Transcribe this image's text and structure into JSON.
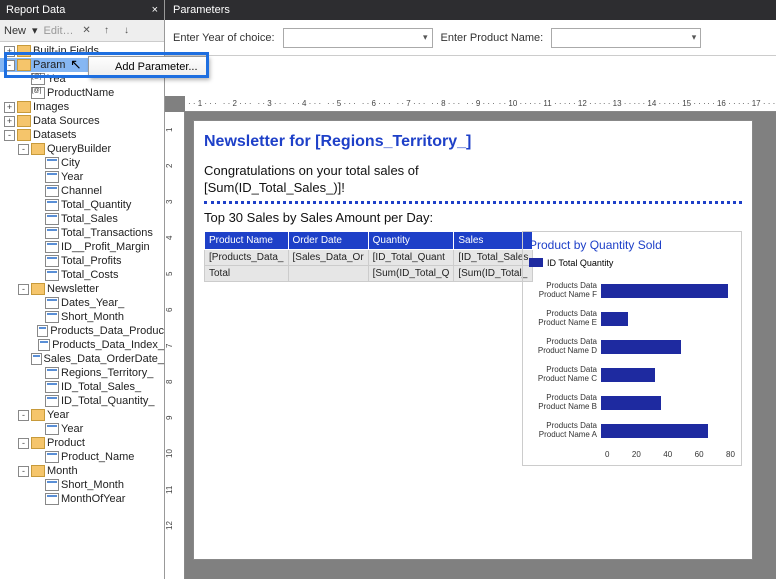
{
  "left": {
    "title": "Report Data",
    "toolbar": {
      "new": "New",
      "edit": "Edit…"
    },
    "tree": [
      {
        "depth": 0,
        "expander": "+",
        "icon": "folder",
        "label": "Built-in Fields"
      },
      {
        "depth": 0,
        "expander": "-",
        "icon": "folder",
        "label": "Param",
        "selected": true
      },
      {
        "depth": 1,
        "expander": "",
        "icon": "param",
        "label": "Yea"
      },
      {
        "depth": 1,
        "expander": "",
        "icon": "param",
        "label": "ProductName"
      },
      {
        "depth": 0,
        "expander": "+",
        "icon": "folder",
        "label": "Images"
      },
      {
        "depth": 0,
        "expander": "+",
        "icon": "folder",
        "label": "Data Sources"
      },
      {
        "depth": 0,
        "expander": "-",
        "icon": "folder",
        "label": "Datasets"
      },
      {
        "depth": 1,
        "expander": "-",
        "icon": "folder",
        "label": "QueryBuilder"
      },
      {
        "depth": 2,
        "expander": "",
        "icon": "field",
        "label": "City"
      },
      {
        "depth": 2,
        "expander": "",
        "icon": "field",
        "label": "Year"
      },
      {
        "depth": 2,
        "expander": "",
        "icon": "field",
        "label": "Channel"
      },
      {
        "depth": 2,
        "expander": "",
        "icon": "field",
        "label": "Total_Quantity"
      },
      {
        "depth": 2,
        "expander": "",
        "icon": "field",
        "label": "Total_Sales"
      },
      {
        "depth": 2,
        "expander": "",
        "icon": "field",
        "label": "Total_Transactions"
      },
      {
        "depth": 2,
        "expander": "",
        "icon": "field",
        "label": "ID__Profit_Margin"
      },
      {
        "depth": 2,
        "expander": "",
        "icon": "field",
        "label": "Total_Profits"
      },
      {
        "depth": 2,
        "expander": "",
        "icon": "field",
        "label": "Total_Costs"
      },
      {
        "depth": 1,
        "expander": "-",
        "icon": "folder",
        "label": "Newsletter"
      },
      {
        "depth": 2,
        "expander": "",
        "icon": "field",
        "label": "Dates_Year_"
      },
      {
        "depth": 2,
        "expander": "",
        "icon": "field",
        "label": "Short_Month"
      },
      {
        "depth": 2,
        "expander": "",
        "icon": "field",
        "label": "Products_Data_Produc"
      },
      {
        "depth": 2,
        "expander": "",
        "icon": "field",
        "label": "Products_Data_Index_"
      },
      {
        "depth": 2,
        "expander": "",
        "icon": "field",
        "label": "Sales_Data_OrderDate_"
      },
      {
        "depth": 2,
        "expander": "",
        "icon": "field",
        "label": "Regions_Territory_"
      },
      {
        "depth": 2,
        "expander": "",
        "icon": "field",
        "label": "ID_Total_Sales_"
      },
      {
        "depth": 2,
        "expander": "",
        "icon": "field",
        "label": "ID_Total_Quantity_"
      },
      {
        "depth": 1,
        "expander": "-",
        "icon": "folder",
        "label": "Year"
      },
      {
        "depth": 2,
        "expander": "",
        "icon": "field",
        "label": "Year"
      },
      {
        "depth": 1,
        "expander": "-",
        "icon": "folder",
        "label": "Product"
      },
      {
        "depth": 2,
        "expander": "",
        "icon": "field",
        "label": "Product_Name"
      },
      {
        "depth": 1,
        "expander": "-",
        "icon": "folder",
        "label": "Month"
      },
      {
        "depth": 2,
        "expander": "",
        "icon": "field",
        "label": "Short_Month"
      },
      {
        "depth": 2,
        "expander": "",
        "icon": "field",
        "label": "MonthOfYear"
      }
    ]
  },
  "context_menu": {
    "item": "Add Parameter..."
  },
  "params": {
    "header": "Parameters",
    "label1": "Enter Year of choice:",
    "label2": "Enter Product Name:"
  },
  "ruler_h": [
    "1",
    "2",
    "3",
    "4",
    "5",
    "6",
    "7",
    "8",
    "9",
    "10",
    "11",
    "12",
    "13",
    "14",
    "15",
    "16",
    "17"
  ],
  "ruler_v": [
    "1",
    "2",
    "3",
    "4",
    "5",
    "6",
    "7",
    "8",
    "9",
    "10",
    "11",
    "12"
  ],
  "report": {
    "title": "Newsletter for [Regions_Territory_]",
    "congrats1": "Congratulations on your total sales of",
    "congrats2": "[Sum(ID_Total_Sales_)]!",
    "subtitle": "Top 30 Sales by Sales Amount per Day:",
    "table": {
      "headers": [
        "Product Name",
        "Order Date",
        "Quantity",
        "Sales"
      ],
      "row1": [
        "[Products_Data_",
        "[Sales_Data_Or",
        "[ID_Total_Quant",
        "[ID_Total_Sales"
      ],
      "row2": [
        "Total",
        "",
        "[Sum(ID_Total_Q",
        "[Sum(ID_Total_"
      ]
    }
  },
  "chart_data": {
    "type": "bar",
    "title": "Product by Quantity Sold",
    "legend": "ID Total Quantity",
    "categories": [
      "Products Data Product Name  F",
      "Products Data Product Name  E",
      "Products Data Product Name  D",
      "Products Data Product Name  C",
      "Products Data Product Name  B",
      "Products Data Product Name  A"
    ],
    "values": [
      85,
      18,
      54,
      36,
      40,
      72
    ],
    "xlim": [
      0,
      80
    ],
    "xticks": [
      "0",
      "20",
      "40",
      "60",
      "80"
    ]
  }
}
